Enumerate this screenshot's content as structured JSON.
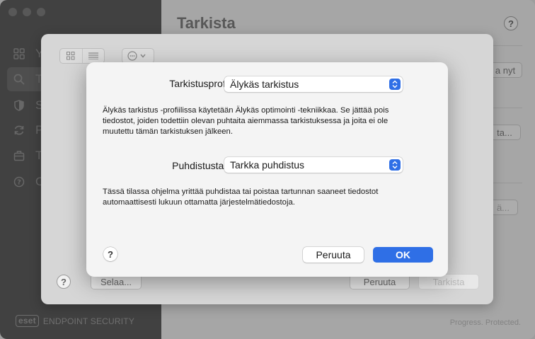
{
  "main": {
    "title": "Tarkista",
    "help_label": "?",
    "bg_btn_now": "a nyt",
    "bg_btn_browse": "ta...",
    "bg_btn_dim": "ä...",
    "tagline": "Progress. Protected."
  },
  "sidebar": {
    "items": [
      {
        "label": "Y",
        "icon": "grid-icon"
      },
      {
        "label": "Ta",
        "icon": "search-icon"
      },
      {
        "label": "S",
        "icon": "shield-icon"
      },
      {
        "label": "P",
        "icon": "refresh-icon"
      },
      {
        "label": "T",
        "icon": "briefcase-icon"
      },
      {
        "label": "O",
        "icon": "question-icon"
      }
    ],
    "brand_logo": "eset",
    "brand_name": "ENDPOINT SECURITY"
  },
  "sheet": {
    "help_label": "?",
    "browse_label": "Selaa...",
    "cancel_label": "Peruuta",
    "scan_label": "Tarkista"
  },
  "dialog": {
    "profile_label": "Tarkistusprofiili:",
    "profile_value": "Älykäs tarkistus",
    "profile_desc_lines": [
      "Älykäs tarkistus -profiilissa käytetään Älykäs optimointi -tekniikkaa. Se jättää pois",
      "tiedostot, joiden todettiin olevan puhtaita aiemmassa tarkistuksessa ja joita ei ole",
      "muutettu tämän tarkistuksen jälkeen."
    ],
    "clean_label": "Puhdistustaso:",
    "clean_value": "Tarkka puhdistus",
    "clean_desc_lines": [
      "Tässä tilassa ohjelma yrittää puhdistaa tai poistaa tartunnan saaneet tiedostot",
      "automaattisesti lukuun ottamatta järjestelmätiedostoja."
    ],
    "help_label": "?",
    "cancel_label": "Peruuta",
    "ok_label": "OK"
  },
  "colors": {
    "accent": "#2f6fe6",
    "sidebar_bg": "#5b5b5b"
  }
}
